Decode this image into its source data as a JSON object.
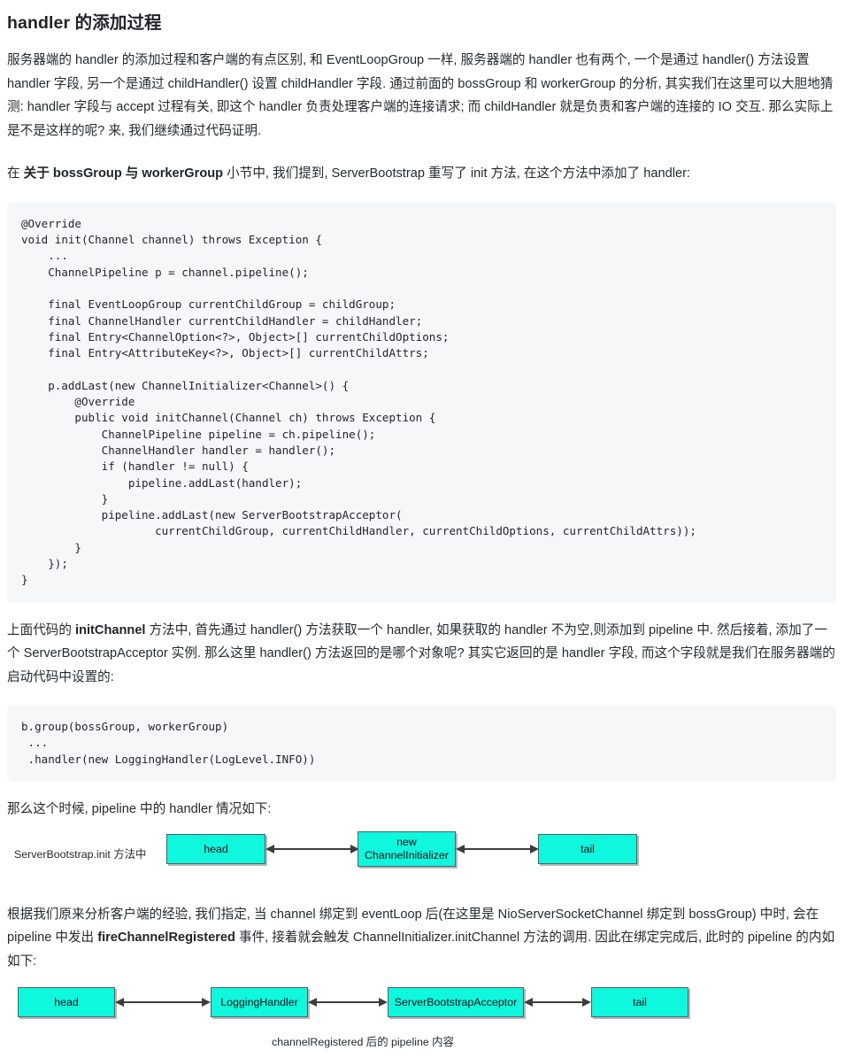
{
  "document": {
    "title": "handler 的添加过程",
    "paragraphs": {
      "intro": "服务器端的 handler 的添加过程和客户端的有点区别, 和 EventLoopGroup 一样, 服务器端的 handler 也有两个, 一个是通过 handler() 方法设置 handler 字段, 另一个是通过 childHandler() 设置 childHandler 字段. 通过前面的 bossGroup 和 workerGroup 的分析, 其实我们在这里可以大胆地猜测: handler 字段与 accept 过程有关, 即这个 handler 负责处理客户端的连接请求; 而 childHandler 就是负责和客户端的连接的 IO 交互. 那么实际上是不是这样的呢? 来, 我们继续通过代码证明.",
      "section_ref_prefix": "在 ",
      "section_ref_bold": "关于 bossGroup 与 workerGroup",
      "section_ref_suffix": " 小节中, 我们提到, ServerBootstrap 重写了 init 方法, 在这个方法中添加了 handler:",
      "after_code_1": "上面代码的 initChannel 方法中, 首先通过 handler() 方法获取一个 handler, 如果获取的 handler 不为空,则添加到 pipeline 中. 然后接着, 添加了一个 ServerBootstrapAcceptor 实例. 那么这里 handler() 方法返回的是哪个对象呢? 其实它返回的是 handler 字段, 而这个字段就是我们在服务器端的启动代码中设置的:",
      "after_code_1_bold": "initChannel",
      "before_diagram_1": "那么这个时候, pipeline 中的 handler 情况如下:",
      "after_diagram_1": "根据我们原来分析客户端的经验, 我们指定, 当 channel 绑定到 eventLoop 后(在这里是 NioServerSocketChannel 绑定到 bossGroup) 中时, 会在 pipeline 中发出 fireChannelRegistered 事件, 接着就会触发 ChannelInitializer.initChannel 方法的调用. 因此在绑定完成后, 此时的 pipeline 的内如如下:",
      "after_diagram_1_bold": "fireChannelRegistered"
    },
    "code_blocks": {
      "init_method": "@Override\nvoid init(Channel channel) throws Exception {\n    ...\n    ChannelPipeline p = channel.pipeline();\n\n    final EventLoopGroup currentChildGroup = childGroup;\n    final ChannelHandler currentChildHandler = childHandler;\n    final Entry<ChannelOption<?>, Object>[] currentChildOptions;\n    final Entry<AttributeKey<?>, Object>[] currentChildAttrs;\n\n    p.addLast(new ChannelInitializer<Channel>() {\n        @Override\n        public void initChannel(Channel ch) throws Exception {\n            ChannelPipeline pipeline = ch.pipeline();\n            ChannelHandler handler = handler();\n            if (handler != null) {\n                pipeline.addLast(handler);\n            }\n            pipeline.addLast(new ServerBootstrapAcceptor(\n                    currentChildGroup, currentChildHandler, currentChildOptions, currentChildAttrs));\n        }\n    });\n}",
      "bootstrap_setup": "b.group(bossGroup, workerGroup)\n ...\n .handler(new LoggingHandler(LogLevel.INFO))"
    },
    "diagram_1": {
      "side_label": "ServerBootstrap.init 方法中",
      "boxes": [
        {
          "label": "head"
        },
        {
          "label": "new\nChannelInitializer",
          "line1": "new",
          "line2": "ChannelInitializer"
        },
        {
          "label": "tail"
        }
      ],
      "box_fill": "#0ff7dd",
      "box_border": "#555f66"
    },
    "diagram_2": {
      "boxes": [
        {
          "label": "head"
        },
        {
          "label": "LoggingHandler"
        },
        {
          "label": "ServerBootstrapAcceptor"
        },
        {
          "label": "tail"
        }
      ],
      "caption": "channelRegistered 后的 pipeline 内容",
      "box_fill": "#0ff7dd",
      "box_border": "#555f66"
    },
    "colors": {
      "page_background": "#ffffff",
      "text": "#24292f",
      "heading": "#1f2328",
      "code_background": "#f6f7f9",
      "diagram_box_fill": "#0ff7dd",
      "diagram_box_border": "#555f66",
      "arrow": "#3d3d3d"
    }
  }
}
